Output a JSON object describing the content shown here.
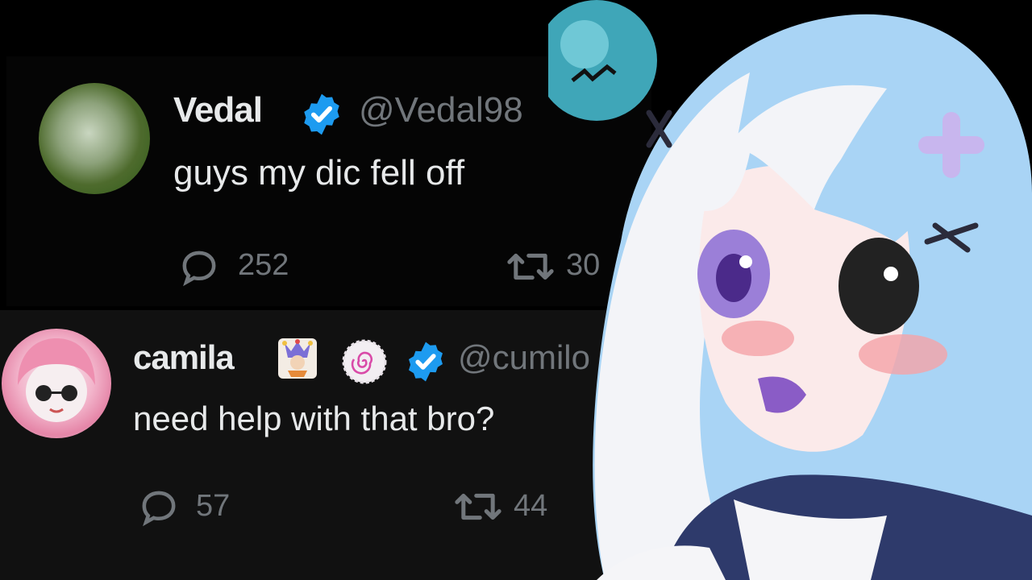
{
  "tweets": [
    {
      "display_name": "Vedal",
      "handle": "@Vedal98",
      "text": "guys my dic   fell off",
      "reply_count": "252",
      "retweet_count": "30",
      "avatar_icon": "lizard-avatar",
      "verified_icon": "verified-badge-icon"
    },
    {
      "display_name": "camila",
      "handle": "@cumilo",
      "text": "need help with that bro?",
      "reply_count": "57",
      "retweet_count": "44",
      "avatar_icon": "anime-girl-avatar",
      "badge_icons": [
        "jester-emoji-icon",
        "spiral-badge-icon",
        "verified-badge-icon"
      ]
    }
  ],
  "colors": {
    "background": "#000000",
    "text_primary": "#e7e9ea",
    "text_secondary": "#71767b",
    "verified_blue": "#1d9bf0",
    "character_hair": "#a9d4f5",
    "character_eye": "#9b7fd8"
  }
}
